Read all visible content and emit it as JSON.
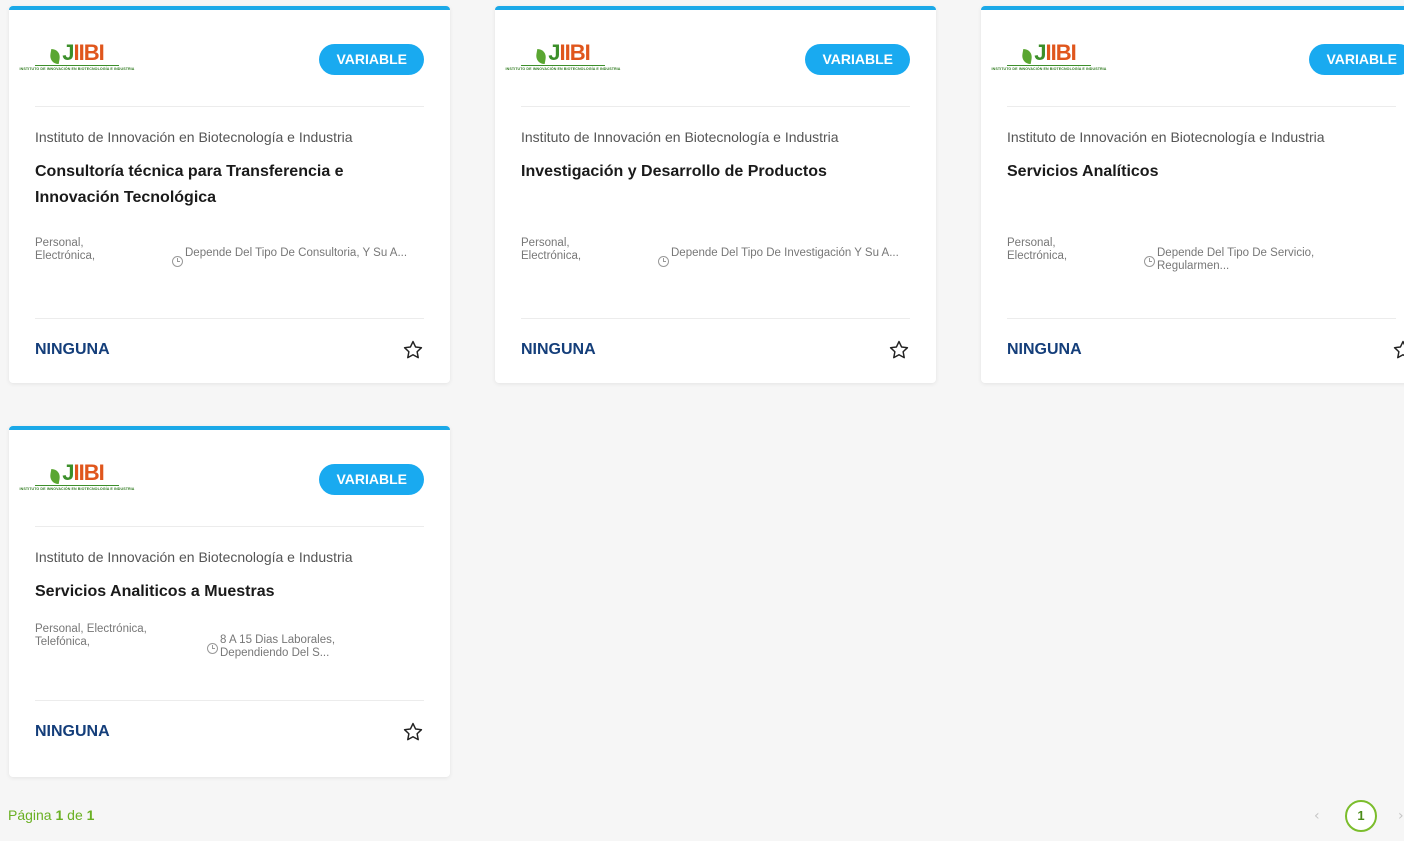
{
  "logo": {
    "text_a": "J",
    "text_b": "IIBI",
    "subtitle": "INSTITUTO DE INNOVACIÓN EN BIOTECNOLOGÍA E INDUSTRIA"
  },
  "cards": [
    {
      "badge": "VARIABLE",
      "institution": "Instituto de Innovación en Biotecnología e Industria",
      "service": "Consultoría técnica para Transferencia e Innovación Tecnológica",
      "channels_line1": "Personal,",
      "channels_line2": "Electrónica,",
      "time": "Depende Del Tipo De Consultoria, Y Su A...",
      "cost": "NINGUNA"
    },
    {
      "badge": "VARIABLE",
      "institution": "Instituto de Innovación en Biotecnología e Industria",
      "service": "Investigación y Desarrollo de Productos",
      "channels_line1": "Personal,",
      "channels_line2": "Electrónica,",
      "time": "Depende Del Tipo De Investigación Y Su A...",
      "cost": "NINGUNA"
    },
    {
      "badge": "VARIABLE",
      "institution": "Instituto de Innovación en Biotecnología e Industria",
      "service": "Servicios Analíticos",
      "channels_line1": "Personal,",
      "channels_line2": "Electrónica,",
      "time": "Depende Del Tipo De Servicio, Regularmen...",
      "cost": "NINGUNA"
    },
    {
      "badge": "VARIABLE",
      "institution": "Instituto de Innovación en Biotecnología e Industria",
      "service": "Servicios Analiticos a Muestras",
      "channels_line1": "Personal, Electrónica,",
      "channels_line2": "Telefónica,",
      "time": "8 A 15 Dias Laborales, Dependiendo Del S...",
      "cost": "NINGUNA"
    }
  ],
  "pagination": {
    "label_prefix": "Página",
    "current": "1",
    "label_mid": "de",
    "total": "1",
    "page_button": "1",
    "prev": "‹",
    "next": "›"
  },
  "colors": {
    "accent": "#1ba9e8",
    "badge": "#19aaf0",
    "cost": "#143e7a",
    "pager_green": "#6ab023"
  }
}
